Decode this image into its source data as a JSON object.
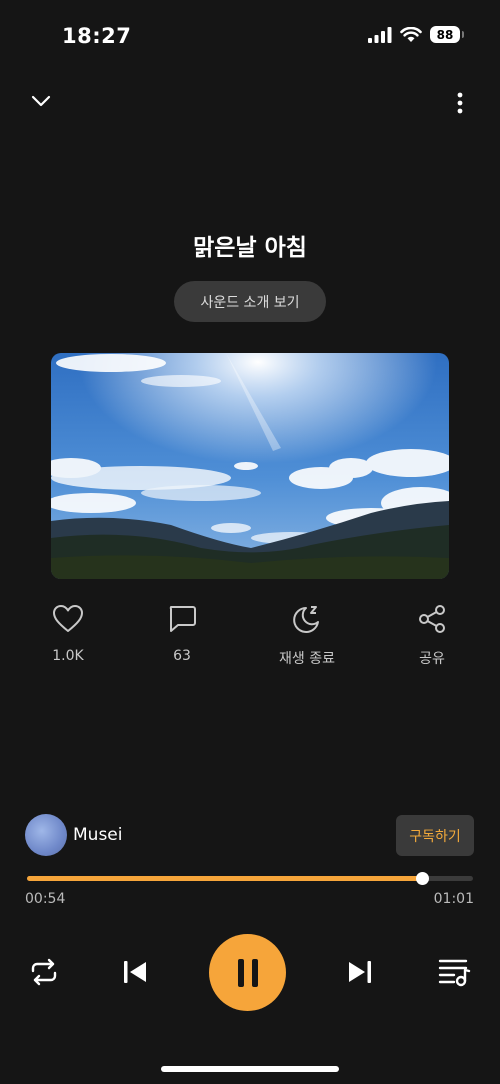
{
  "status_bar": {
    "time": "18:27",
    "battery": "88"
  },
  "track": {
    "title": "맑은날 아침"
  },
  "intro_button_label": "사운드 소개 보기",
  "actions": {
    "like_count": "1.0K",
    "comment_count": "63",
    "sleep_timer_label": "재생 종료",
    "share_label": "공유"
  },
  "channel": {
    "name": "Musei",
    "subscribe_label": "구독하기"
  },
  "playback": {
    "current_time": "00:54",
    "total_time": "01:01",
    "progress": 0.885
  },
  "colors": {
    "accent": "#f6a53a",
    "background": "#151515",
    "pill": "#3a3a3a"
  },
  "icons": {
    "header": [
      "chevron-down-icon",
      "more-vertical-icon"
    ],
    "actions": [
      "heart-icon",
      "comment-icon",
      "moon-sleep-icon",
      "share-icon"
    ],
    "controls": [
      "repeat-icon",
      "skip-previous-icon",
      "pause-icon",
      "skip-next-icon",
      "playlist-icon"
    ]
  }
}
